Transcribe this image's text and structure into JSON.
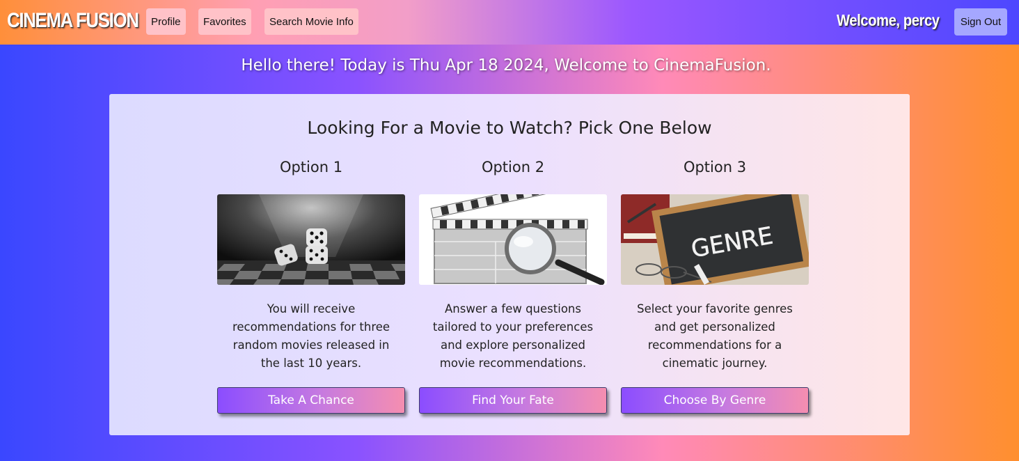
{
  "header": {
    "logo": "CINEMA FUSION",
    "nav": [
      "Profile",
      "Favorites",
      "Search Movie Info"
    ],
    "welcome": "Welcome, percy",
    "signout": "Sign Out"
  },
  "greeting": "Hello there! Today is Thu Apr 18 2024, Welcome to CinemaFusion.",
  "panel": {
    "title": "Looking For a Movie to Watch? Pick One Below",
    "options": [
      {
        "title": "Option 1",
        "image_icon": "dice-on-chessboard-image",
        "desc_lines": [
          "You will receive",
          "recommendations for three",
          "random movies released in",
          "the last 10 years."
        ],
        "button": "Take A Chance"
      },
      {
        "title": "Option 2",
        "image_icon": "clapperboard-magnifier-image",
        "desc_lines": [
          "Answer a few questions",
          "tailored to your preferences",
          "and explore personalized",
          "movie recommendations."
        ],
        "button": "Find Your Fate"
      },
      {
        "title": "Option 3",
        "image_icon": "genre-chalkboard-image",
        "image_text": "GENRE",
        "desc_lines": [
          "Select your favorite genres",
          "and get personalized",
          "recommendations for a",
          "cinematic journey."
        ],
        "button": "Choose By Genre"
      }
    ]
  }
}
